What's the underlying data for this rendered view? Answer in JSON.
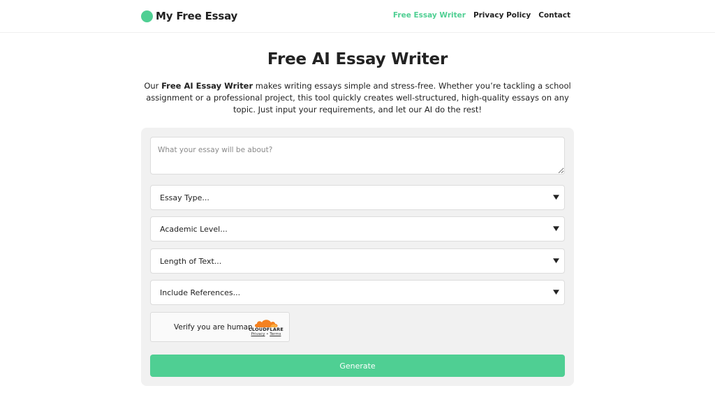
{
  "header": {
    "brand": "My Free Essay",
    "nav": [
      "Free Essay Writer",
      "Privacy Policy",
      "Contact"
    ]
  },
  "main": {
    "title": "Free AI Essay Writer",
    "intro_prefix": "Our ",
    "intro_bold": "Free AI Essay Writer",
    "intro_rest": " makes writing essays simple and stress-free. Whether you’re tackling a school assignment or a professional project, this tool quickly creates well-structured, high-quality essays on any topic. Just input your requirements, and let our AI do the rest!"
  },
  "form": {
    "topic_placeholder": "What your essay will be about?",
    "essay_type": "Essay Type...",
    "academic_level": "Academic Level...",
    "length": "Length of Text...",
    "references": "Include References...",
    "captcha_label": "Verify you are human",
    "captcha_brand": "CLOUDFLARE",
    "captcha_privacy": "Privacy",
    "captcha_sep": "•",
    "captcha_terms": "Terms",
    "generate_label": "Generate"
  },
  "colors": {
    "accent": "#4fcf93",
    "cloudflare_orange": "#f48120"
  },
  "icons": {
    "brand": "circle-logo-icon",
    "select": "chevron-down-icon",
    "captcha": "cloudflare-cloud-icon"
  }
}
